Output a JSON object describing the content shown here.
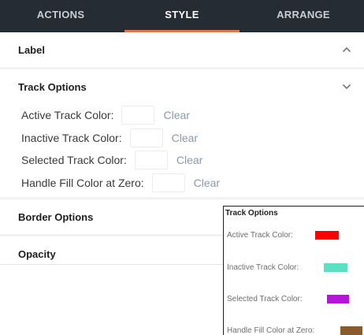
{
  "tabs": [
    {
      "label": "ACTIONS",
      "active": false
    },
    {
      "label": "STYLE",
      "active": true
    },
    {
      "label": "ARRANGE",
      "active": false
    }
  ],
  "sections": {
    "label": {
      "title": "Label",
      "icon": "chevron-up-icon"
    },
    "track_options": {
      "title": "Track Options",
      "icon": "chevron-down-icon",
      "options": [
        {
          "label": "Active Track Color:",
          "clear": "Clear"
        },
        {
          "label": "Inactive Track Color:",
          "clear": "Clear"
        },
        {
          "label": "Selected Track Color:",
          "clear": "Clear"
        },
        {
          "label": "Handle Fill Color at Zero:",
          "clear": "Clear"
        }
      ]
    },
    "border_options": {
      "title": "Border Options"
    },
    "opacity": {
      "title": "Opacity"
    }
  },
  "popup": {
    "title": "Track Options",
    "rows": [
      {
        "label": "Active Track Color:",
        "color": "#ff0000"
      },
      {
        "label": "Inactive Track Color:",
        "color": "#5ce0c4"
      },
      {
        "label": "Selected Track Color:",
        "color": "#b316d9"
      },
      {
        "label": "Handle Fill Color at Zero:",
        "color": "#8b5a2b"
      }
    ]
  },
  "colors": {
    "tab_bar": "#262c33",
    "tab_accent": "#e8734a",
    "clear_link": "#8a9ab0"
  }
}
